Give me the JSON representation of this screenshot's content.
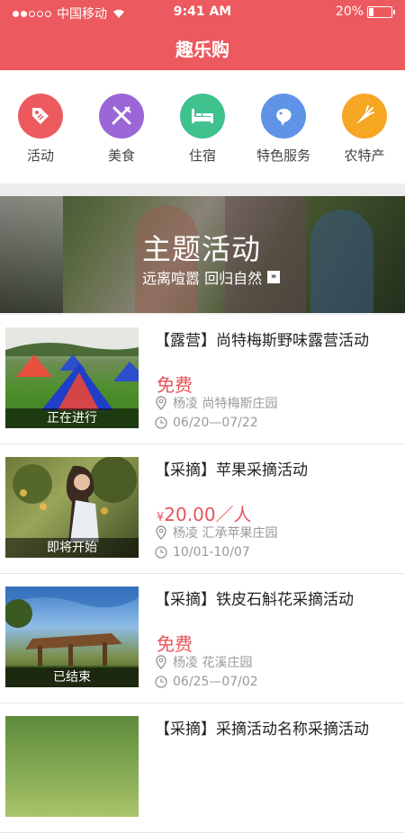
{
  "status_bar": {
    "carrier": "中国移动",
    "time": "9:41 AM",
    "battery": "20%",
    "battery_level": 0.2
  },
  "header": {
    "title": "趣乐购"
  },
  "categories": [
    {
      "label": "活动",
      "icon": "tag-icon",
      "color": "#ec5a5f"
    },
    {
      "label": "美食",
      "icon": "utensils-icon",
      "color": "#9b66d6"
    },
    {
      "label": "住宿",
      "icon": "bed-icon",
      "color": "#3fc28e"
    },
    {
      "label": "特色服务",
      "icon": "service-icon",
      "color": "#5f93e8"
    },
    {
      "label": "农特产",
      "icon": "carrot-icon",
      "color": "#f5a623"
    }
  ],
  "banner": {
    "title": "主题活动",
    "subtitle": "远离喧嚣 回归自然"
  },
  "activities": [
    {
      "title": "【露营】尚特梅斯野味露营活动",
      "price": "免费",
      "location": "杨凌  尚特梅斯庄园",
      "date": "06/20—07/22",
      "status": "正在进行"
    },
    {
      "title": "【采摘】苹果采摘活动",
      "price_symbol": "¥",
      "price": "20.00／人",
      "location": "杨凌  汇承苹果庄园",
      "date": "10/01-10/07",
      "status": "即将开始"
    },
    {
      "title": "【采摘】铁皮石斛花采摘活动",
      "price": "免费",
      "location": "杨凌  花溪庄园",
      "date": "06/25—07/02",
      "status": "已结束"
    },
    {
      "title": "【采摘】采摘活动名称采摘活动"
    }
  ],
  "colors": {
    "primary": "#ec5a5f",
    "price": "#e8545a"
  }
}
